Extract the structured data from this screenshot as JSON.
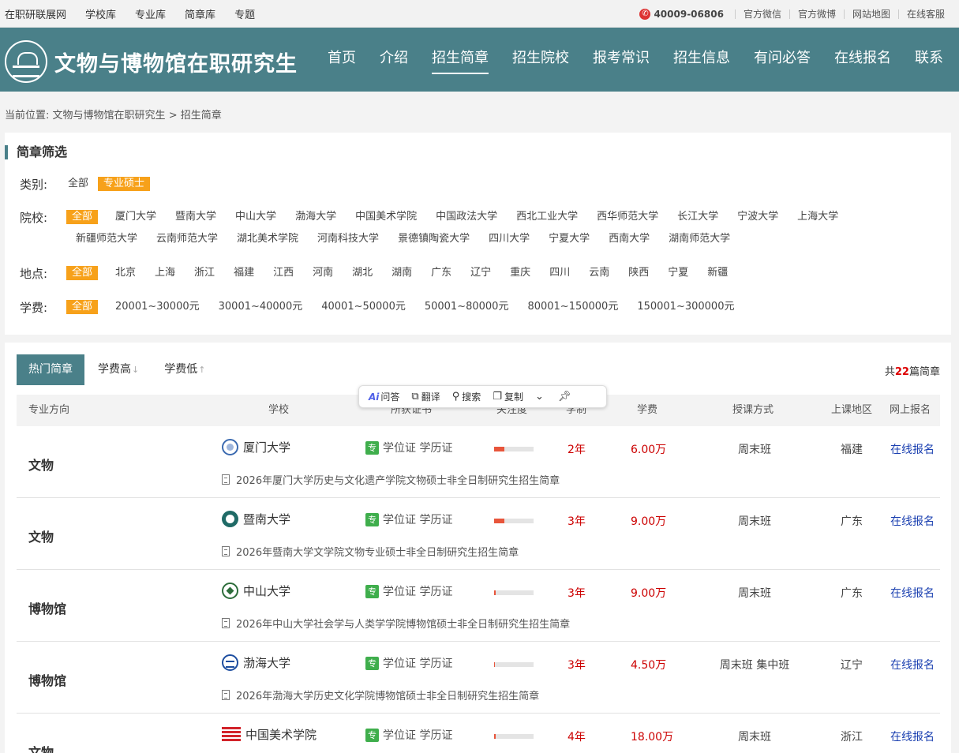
{
  "topbar": {
    "links": [
      "在职研联展网",
      "学校库",
      "专业库",
      "简章库",
      "专题"
    ],
    "phone": "40009-06806",
    "right_links": [
      "官方微信",
      "官方微博",
      "网站地图",
      "在线客服"
    ]
  },
  "header": {
    "title": "文物与博物馆在职研究生",
    "nav": [
      "首页",
      "介绍",
      "招生简章",
      "招生院校",
      "报考常识",
      "招生信息",
      "有问必答",
      "在线报名",
      "联系"
    ],
    "active_nav": "招生简章"
  },
  "breadcrumb": {
    "label": "当前位置:",
    "home": "文物与博物馆在职研究生",
    "sep": ">",
    "current": "招生简章"
  },
  "filter": {
    "title": "简章筛选",
    "category": {
      "label": "类别:",
      "options": [
        "全部",
        "专业硕士"
      ],
      "selected": "专业硕士"
    },
    "school": {
      "label": "院校:",
      "options": [
        "全部",
        "厦门大学",
        "暨南大学",
        "中山大学",
        "渤海大学",
        "中国美术学院",
        "中国政法大学",
        "西北工业大学",
        "西华师范大学",
        "长江大学",
        "宁波大学",
        "上海大学",
        "新疆师范大学",
        "云南师范大学",
        "湖北美术学院",
        "河南科技大学",
        "景德镇陶瓷大学",
        "四川大学",
        "宁夏大学",
        "西南大学",
        "湖南师范大学"
      ],
      "selected": "全部"
    },
    "location": {
      "label": "地点:",
      "options": [
        "全部",
        "北京",
        "上海",
        "浙江",
        "福建",
        "江西",
        "河南",
        "湖北",
        "湖南",
        "广东",
        "辽宁",
        "重庆",
        "四川",
        "云南",
        "陕西",
        "宁夏",
        "新疆"
      ],
      "selected": "全部"
    },
    "tuition": {
      "label": "学费:",
      "options": [
        "全部",
        "20001~30000元",
        "30001~40000元",
        "40001~50000元",
        "50001~80000元",
        "80001~150000元",
        "150001~300000元"
      ],
      "selected": "全部"
    }
  },
  "list": {
    "tabs": [
      {
        "label": "热门简章",
        "arrow": ""
      },
      {
        "label": "学费高",
        "arrow": "↓"
      },
      {
        "label": "学费低",
        "arrow": "↑"
      }
    ],
    "active_tab": "热门简章",
    "total_prefix": "共",
    "total_count": "22",
    "total_suffix": "篇简章",
    "columns": [
      "专业方向",
      "学校",
      "所获证书",
      "关注度",
      "学制",
      "学费",
      "授课方式",
      "上课地区",
      "网上报名"
    ],
    "rows": [
      {
        "direction": "文物",
        "school": "厦门大学",
        "cert_badge": "专",
        "certs": "学位证 学历证",
        "attention": 0.26,
        "years": "2年",
        "fee": "6.00万",
        "mode": "周末班",
        "region": "福建",
        "register": "在线报名",
        "brochure": "2026年厦门大学历史与文化遗产学院文物硕士非全日制研究生招生简章"
      },
      {
        "direction": "文物",
        "school": "暨南大学",
        "cert_badge": "专",
        "certs": "学位证 学历证",
        "attention": 0.26,
        "years": "3年",
        "fee": "9.00万",
        "mode": "周末班",
        "region": "广东",
        "register": "在线报名",
        "brochure": "2026年暨南大学文学院文物专业硕士非全日制研究生招生简章"
      },
      {
        "direction": "博物馆",
        "school": "中山大学",
        "cert_badge": "专",
        "certs": "学位证 学历证",
        "attention": 0.04,
        "years": "3年",
        "fee": "9.00万",
        "mode": "周末班",
        "region": "广东",
        "register": "在线报名",
        "brochure": "2026年中山大学社会学与人类学学院博物馆硕士非全日制研究生招生简章"
      },
      {
        "direction": "博物馆",
        "school": "渤海大学",
        "cert_badge": "专",
        "certs": "学位证 学历证",
        "attention": 0.02,
        "years": "3年",
        "fee": "4.50万",
        "mode": "周末班 集中班",
        "region": "辽宁",
        "register": "在线报名",
        "brochure": "2026年渤海大学历史文化学院博物馆硕士非全日制研究生招生简章"
      },
      {
        "direction": "文物",
        "school": "中国美术学院",
        "cert_badge": "专",
        "certs": "学位证 学历证",
        "attention": 0.04,
        "years": "4年",
        "fee": "18.00万",
        "mode": "周末班",
        "region": "浙江",
        "register": "在线报名",
        "brochure": ""
      }
    ]
  },
  "popup": {
    "ai": "Ai",
    "items": [
      "问答",
      "翻译",
      "搜索",
      "复制"
    ]
  }
}
